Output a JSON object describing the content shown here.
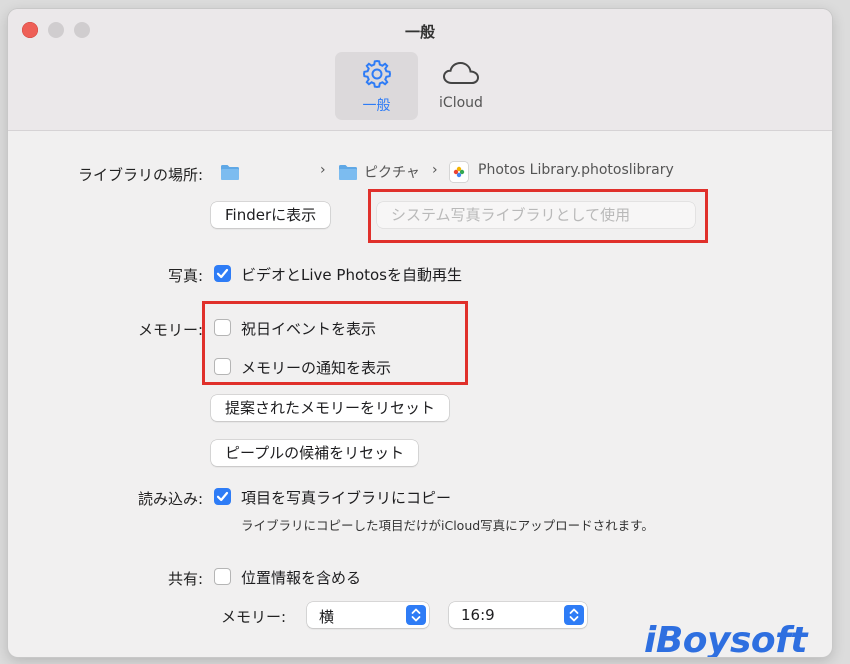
{
  "window": {
    "title": "一般"
  },
  "tabs": [
    {
      "label": "一般",
      "icon": "gear-icon",
      "selected": true
    },
    {
      "label": "iCloud",
      "icon": "cloud-icon",
      "selected": false
    }
  ],
  "library": {
    "label": "ライブラリの場所:",
    "path": [
      {
        "name": "",
        "icon": "folder-icon"
      },
      {
        "name": "ピクチャ",
        "icon": "folder-icon"
      },
      {
        "name": "Photos Library.photoslibrary",
        "icon": "photos-library-icon"
      }
    ],
    "show_in_finder": "Finderに表示",
    "use_as_system_library": "システム写真ライブラリとして使用"
  },
  "photos": {
    "label": "写真:",
    "autoplay": {
      "text": "ビデオとLive Photosを自動再生",
      "checked": true
    }
  },
  "memories": {
    "label": "メモリー:",
    "show_holidays": {
      "text": "祝日イベントを表示",
      "checked": false
    },
    "show_notifications": {
      "text": "メモリーの通知を表示",
      "checked": false
    },
    "reset_suggested": "提案されたメモリーをリセット",
    "reset_people": "ピープルの候補をリセット"
  },
  "importing": {
    "label": "読み込み:",
    "copy_items": {
      "text": "項目を写真ライブラリにコピー",
      "checked": true
    },
    "note": "ライブラリにコピーした項目だけがiCloud写真にアップロードされます。"
  },
  "sharing": {
    "label": "共有:",
    "include_location": {
      "text": "位置情報を含める",
      "checked": false
    }
  },
  "memories_format": {
    "label": "メモリー:",
    "orientation": "横",
    "aspect": "16:9"
  },
  "watermark": "iBoysoft",
  "colors": {
    "accent": "#2e7cf6",
    "highlight": "#e0302b"
  }
}
